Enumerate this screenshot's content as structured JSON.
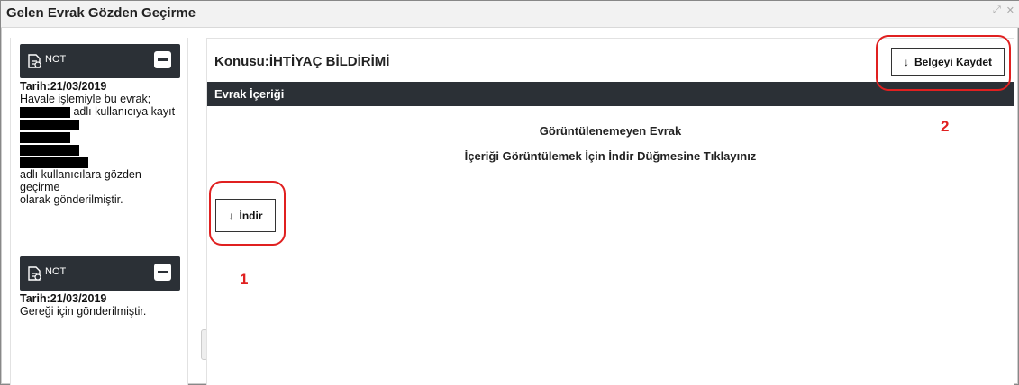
{
  "window": {
    "title": "Gelen Evrak Gözden Geçirme",
    "controls": [
      "⤢",
      "✕"
    ]
  },
  "notes": [
    {
      "label": "NOT",
      "date": "Tarih:21/03/2019",
      "lines": [
        "Havale işlemiyle bu evrak;",
        "adlı kullanıcıya kayıt",
        "adlı kullanıcılara gözden",
        "geçirme",
        "olarak gönderilmiştir."
      ]
    },
    {
      "label": "NOT",
      "date": "Tarih:21/03/2019",
      "lines": [
        "Gereği için gönderilmiştir."
      ]
    }
  ],
  "main": {
    "subject": "Konusu:İHTİYAÇ BİLDİRİMİ",
    "save_button": "Belgeyi Kaydet",
    "section_title": "Evrak İçeriği",
    "doc_heading": "Görüntülenemeyen Evrak",
    "doc_instruction": "İçeriği Görüntülemek İçin İndir Düğmesine Tıklayınız",
    "download_button": "İndir",
    "arrow_glyph": "↓"
  },
  "annotations": [
    "1",
    "2"
  ],
  "colors": {
    "dark_bar": "#2b3036",
    "annotation_red": "#e02020"
  },
  "icons": [
    "note-doc-icon",
    "collapse-minus-icon",
    "download-arrow-icon",
    "expand-window-icon",
    "close-icon"
  ]
}
